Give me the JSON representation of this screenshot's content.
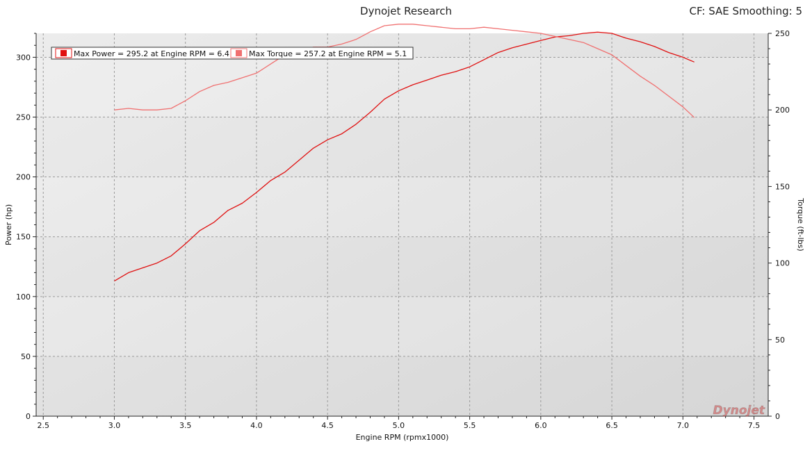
{
  "header": {
    "title": "Dynojet Research",
    "cf_label": "CF: SAE Smoothing: 5"
  },
  "watermark": "Dynojet",
  "colors": {
    "power": "#e01010",
    "torque": "#f07070",
    "plot_bg": "#e6e6e6"
  },
  "chart_data": {
    "type": "line",
    "title": "Dynojet Research",
    "xlabel": "Engine RPM (rpmx1000)",
    "ylabel": "Power (hp)",
    "y2label": "Torque (ft-lbs)",
    "xlim": [
      2.45,
      7.6
    ],
    "ylim": [
      0,
      320
    ],
    "y2lim": [
      0,
      250
    ],
    "xticks": [
      "2.5",
      "3.0",
      "3.5",
      "4.0",
      "4.5",
      "5.0",
      "5.5",
      "6.0",
      "6.5",
      "7.0",
      "7.5"
    ],
    "yticks": [
      "0",
      "50",
      "100",
      "150",
      "200",
      "250",
      "300"
    ],
    "y2ticks": [
      "0",
      "50",
      "100",
      "150",
      "200",
      "250"
    ],
    "grid": true,
    "legend_position": "top-left",
    "legend": [
      {
        "label": "Max Power = 295.2 at Engine RPM = 6.4"
      },
      {
        "label": "Max Torque = 257.2 at Engine RPM = 5.1"
      }
    ],
    "series": [
      {
        "name": "Power",
        "axis": "left",
        "x": [
          3.0,
          3.1,
          3.2,
          3.3,
          3.4,
          3.5,
          3.6,
          3.7,
          3.8,
          3.9,
          4.0,
          4.1,
          4.2,
          4.3,
          4.4,
          4.5,
          4.6,
          4.7,
          4.8,
          4.9,
          5.0,
          5.1,
          5.2,
          5.3,
          5.4,
          5.5,
          5.6,
          5.7,
          5.8,
          5.9,
          6.0,
          6.1,
          6.2,
          6.3,
          6.4,
          6.5,
          6.6,
          6.7,
          6.8,
          6.9,
          7.0,
          7.08
        ],
        "values": [
          113,
          120,
          124,
          128,
          134,
          144,
          155,
          162,
          172,
          178,
          187,
          197,
          204,
          214,
          224,
          231,
          236,
          244,
          254,
          265,
          272,
          277,
          281,
          285,
          288,
          292,
          298,
          304,
          308,
          311,
          314,
          317,
          318,
          320,
          321,
          320,
          316,
          313,
          309,
          304,
          300,
          296
        ]
      },
      {
        "name": "Torque",
        "axis": "right",
        "x": [
          3.0,
          3.1,
          3.2,
          3.3,
          3.4,
          3.5,
          3.6,
          3.7,
          3.8,
          3.9,
          4.0,
          4.1,
          4.2,
          4.3,
          4.4,
          4.5,
          4.6,
          4.7,
          4.8,
          4.9,
          5.0,
          5.1,
          5.2,
          5.3,
          5.4,
          5.5,
          5.6,
          5.7,
          5.8,
          5.9,
          6.0,
          6.1,
          6.2,
          6.3,
          6.4,
          6.5,
          6.6,
          6.7,
          6.8,
          6.9,
          7.0,
          7.08
        ],
        "values": [
          200,
          201,
          200,
          200,
          201,
          206,
          212,
          216,
          218,
          221,
          224,
          230,
          236,
          238,
          241,
          241,
          243,
          246,
          251,
          255,
          256,
          256,
          255,
          254,
          253,
          253,
          254,
          253,
          252,
          251,
          250,
          248,
          246,
          244,
          240,
          236,
          229,
          222,
          216,
          209,
          202,
          195
        ]
      }
    ]
  }
}
